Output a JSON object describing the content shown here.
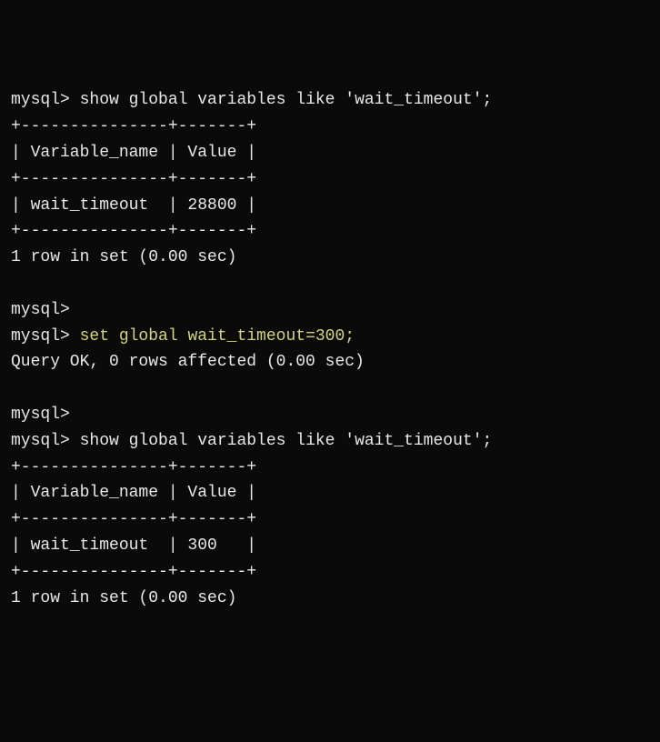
{
  "lines": [
    {
      "segments": [
        {
          "text": "mysql> ",
          "cls": "prompt"
        },
        {
          "text": "show global variables like 'wait_timeout';",
          "cls": "cmd"
        }
      ]
    },
    {
      "segments": [
        {
          "text": "+---------------+-------+",
          "cls": ""
        }
      ]
    },
    {
      "segments": [
        {
          "text": "| Variable_name | Value |",
          "cls": ""
        }
      ]
    },
    {
      "segments": [
        {
          "text": "+---------------+-------+",
          "cls": ""
        }
      ]
    },
    {
      "segments": [
        {
          "text": "| wait_timeout  | 28800 |",
          "cls": ""
        }
      ]
    },
    {
      "segments": [
        {
          "text": "+---------------+-------+",
          "cls": ""
        }
      ]
    },
    {
      "segments": [
        {
          "text": "1 row in set (0.00 sec)",
          "cls": ""
        }
      ]
    },
    {
      "segments": [
        {
          "text": "",
          "cls": ""
        }
      ]
    },
    {
      "segments": [
        {
          "text": "mysql>",
          "cls": "prompt"
        }
      ]
    },
    {
      "segments": [
        {
          "text": "mysql> ",
          "cls": "prompt"
        },
        {
          "text": "set global wait_timeout=300;",
          "cls": "cmd-highlight"
        }
      ]
    },
    {
      "segments": [
        {
          "text": "Query OK, 0 rows affected (0.00 sec)",
          "cls": ""
        }
      ]
    },
    {
      "segments": [
        {
          "text": "",
          "cls": ""
        }
      ]
    },
    {
      "segments": [
        {
          "text": "mysql>",
          "cls": "prompt"
        }
      ]
    },
    {
      "segments": [
        {
          "text": "mysql> ",
          "cls": "prompt"
        },
        {
          "text": "show global variables like 'wait_timeout';",
          "cls": "cmd"
        }
      ]
    },
    {
      "segments": [
        {
          "text": "+---------------+-------+",
          "cls": ""
        }
      ]
    },
    {
      "segments": [
        {
          "text": "| Variable_name | Value |",
          "cls": ""
        }
      ]
    },
    {
      "segments": [
        {
          "text": "+---------------+-------+",
          "cls": ""
        }
      ]
    },
    {
      "segments": [
        {
          "text": "| wait_timeout  | 300   |",
          "cls": ""
        }
      ]
    },
    {
      "segments": [
        {
          "text": "+---------------+-------+",
          "cls": ""
        }
      ]
    },
    {
      "segments": [
        {
          "text": "1 row in set (0.00 sec)",
          "cls": ""
        }
      ]
    }
  ],
  "queries": {
    "q1": {
      "prompt": "mysql>",
      "command": "show global variables like 'wait_timeout';",
      "table": {
        "headers": [
          "Variable_name",
          "Value"
        ],
        "rows": [
          [
            "wait_timeout",
            "28800"
          ]
        ]
      },
      "result_footer": "1 row in set (0.00 sec)"
    },
    "q2": {
      "prompt": "mysql>",
      "command": "set global wait_timeout=300;",
      "result_footer": "Query OK, 0 rows affected (0.00 sec)"
    },
    "q3": {
      "prompt": "mysql>",
      "command": "show global variables like 'wait_timeout';",
      "table": {
        "headers": [
          "Variable_name",
          "Value"
        ],
        "rows": [
          [
            "wait_timeout",
            "300"
          ]
        ]
      },
      "result_footer": "1 row in set (0.00 sec)"
    }
  }
}
